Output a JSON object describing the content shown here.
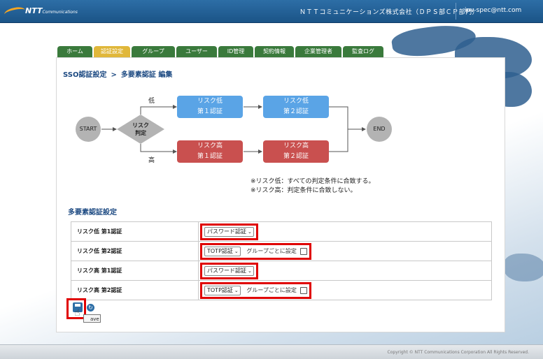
{
  "header": {
    "logo_text": "NTT",
    "logo_sub": "Communications",
    "company": "ＮＴＴコミュニケーションズ株式会社（ＤＰＳ部ＣＰ部門）",
    "user": "ipv-spec@ntt.com"
  },
  "tabs": [
    {
      "label": "ホーム"
    },
    {
      "label": "認証設定"
    },
    {
      "label": "グループ"
    },
    {
      "label": "ユーザー"
    },
    {
      "label": "ID管理"
    },
    {
      "label": "契約情報"
    },
    {
      "label": "企業管理者"
    },
    {
      "label": "監査ログ"
    }
  ],
  "breadcrumb": {
    "parent": "SSO認証設定",
    "separator": ">",
    "current": "多要素認証 編集"
  },
  "diagram": {
    "start": "START",
    "decision_line1": "リスク",
    "decision_line2": "判定",
    "low": "低",
    "high": "高",
    "low1_line1": "リスク低",
    "low1_line2": "第１認証",
    "low2_line1": "リスク低",
    "low2_line2": "第２認証",
    "high1_line1": "リスク高",
    "high1_line2": "第１認証",
    "high2_line1": "リスク高",
    "high2_line2": "第２認証",
    "end": "END",
    "colors": {
      "low": "#5aa4e6",
      "high": "#c9504f"
    }
  },
  "notes": {
    "low": "※リスク低：すべての判定条件に合致する。",
    "high": "※リスク高：判定条件に合致しない。"
  },
  "section_title": "多要素認証設定",
  "rows": [
    {
      "label": "リスク低 第1認証",
      "value": "パスワード認証",
      "group_label": ""
    },
    {
      "label": "リスク低 第2認証",
      "value": "TOTP認証",
      "group_label": "グループごとに設定"
    },
    {
      "label": "リスク高 第1認証",
      "value": "パスワード認証",
      "group_label": ""
    },
    {
      "label": "リスク高 第2認証",
      "value": "TOTP認証",
      "group_label": "グループごとに設定"
    }
  ],
  "tooltip": "ave",
  "footer": "Copyright © NTT Communications Corporation All Rights Reserved."
}
